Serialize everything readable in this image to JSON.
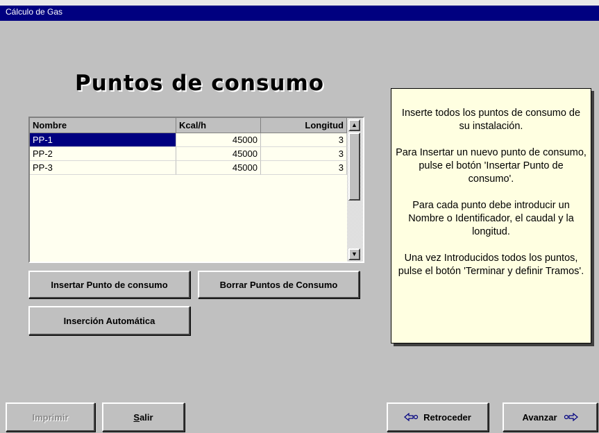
{
  "window": {
    "title": "Cálculo de Gas"
  },
  "page": {
    "title": "Puntos de consumo"
  },
  "grid": {
    "columns": [
      "Nombre",
      "Kcal/h",
      "Longitud"
    ],
    "rows": [
      {
        "nombre": "PP-1",
        "kcal": "45000",
        "longitud": "3"
      },
      {
        "nombre": "PP-2",
        "kcal": "45000",
        "longitud": "3"
      },
      {
        "nombre": "PP-3",
        "kcal": "45000",
        "longitud": "3"
      }
    ],
    "selected_row": 0
  },
  "buttons": {
    "insertar": "Insertar Punto de consumo",
    "borrar": "Borrar Puntos de Consumo",
    "automatica": "Inserción Automática",
    "imprimir": "Imprimir",
    "salir_prefix": "S",
    "salir_rest": "alir",
    "retroceder": "Retroceder",
    "avanzar": "Avanzar"
  },
  "icons": {
    "retroceder": "arrow-left-icon",
    "avanzar": "arrow-right-icon"
  },
  "help": {
    "p1": "Inserte todos los puntos de consumo de su instalación.",
    "p2": "Para Insertar un nuevo punto de consumo, pulse el botón 'Insertar Punto de consumo'.",
    "p3": "Para cada punto debe introducir un Nombre o Identificador, el caudal y la longitud.",
    "p4": "Una vez Introducidos todos los puntos, pulse el botón 'Terminar y definir Tramos'."
  }
}
